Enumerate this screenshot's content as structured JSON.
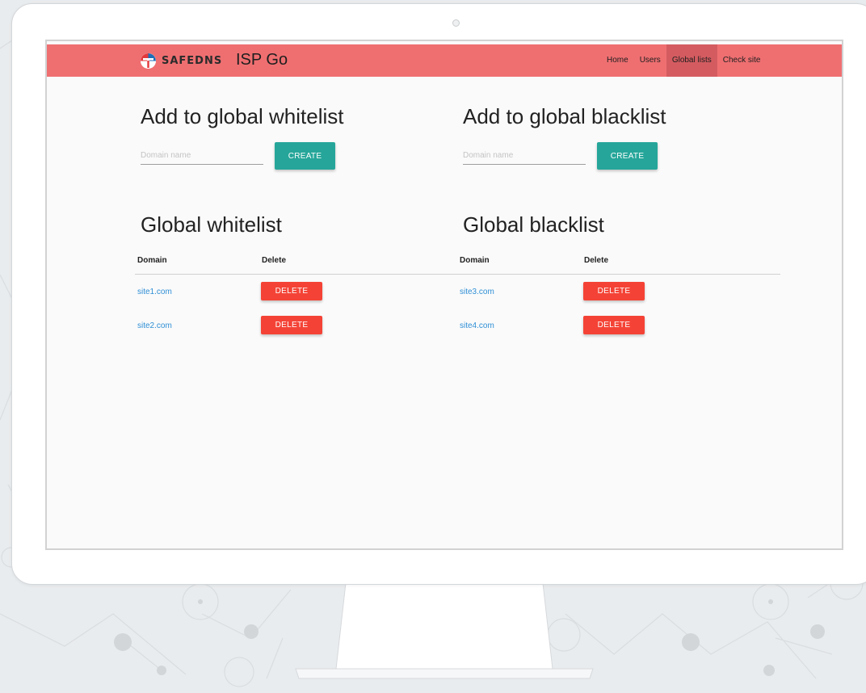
{
  "app": {
    "brand_logo_text": "SAFEDNS",
    "title": "ISP Go"
  },
  "nav": {
    "items": [
      {
        "label": "Home",
        "active": false
      },
      {
        "label": "Users",
        "active": false
      },
      {
        "label": "Global lists",
        "active": true
      },
      {
        "label": "Check site",
        "active": false
      }
    ]
  },
  "whitelist_form": {
    "heading": "Add to global whitelist",
    "placeholder": "Domain name",
    "value": "",
    "button_label": "CREATE"
  },
  "blacklist_form": {
    "heading": "Add to global blacklist",
    "placeholder": "Domain name",
    "value": "",
    "button_label": "CREATE"
  },
  "whitelist": {
    "heading": "Global whitelist",
    "columns": [
      "Domain",
      "Delete"
    ],
    "rows": [
      {
        "domain": "site1.com",
        "action": "DELETE"
      },
      {
        "domain": "site2.com",
        "action": "DELETE"
      }
    ]
  },
  "blacklist": {
    "heading": "Global blacklist",
    "columns": [
      "Domain",
      "Delete"
    ],
    "rows": [
      {
        "domain": "site3.com",
        "action": "DELETE"
      },
      {
        "domain": "site4.com",
        "action": "DELETE"
      }
    ]
  },
  "colors": {
    "navbar": "#ef6f71",
    "nav_active": "#d45c61",
    "create_button": "#26a69a",
    "delete_button": "#f44336",
    "link": "#2f8fd6"
  },
  "icons": {
    "logo": "safedns-logo-icon"
  }
}
